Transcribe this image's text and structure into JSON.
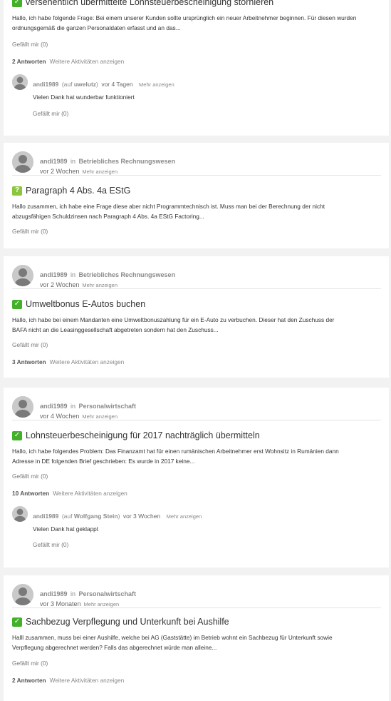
{
  "posts": [
    {
      "title": "versehentlich übermittelte Lohnsteuerbescheinigung stornieren",
      "status": "answered",
      "excerpt": "Hallo,   ich habe folgende Frage:   Bei einem unserer Kunden sollte ursprünglich ein neuer Arbeitnehmer beginnen. Für diesen wurden ordnungsgemäß die ganzen Personaldaten erfasst und an das...",
      "likes": "Gefällt mir (0)",
      "answers": "2 Antworten",
      "activities": "Weitere Aktivitäten anzeigen",
      "reply": {
        "user": "andi1989",
        "paren_open": "(auf ",
        "to": "uwelutz",
        "paren_close": ")",
        "time": "vor 4 Tagen",
        "more": "Mehr anzeigen",
        "text": "Vielen Dank hat wunderbar funktioniert",
        "likes": "Gefällt mir (0)"
      }
    },
    {
      "user": "andi1989",
      "in": "in",
      "place": "Betriebliches Rechnungswesen",
      "time": "vor 2 Wochen",
      "more": "Mehr anzeigen",
      "title": "Paragraph 4 Abs. 4a EStG",
      "status": "open",
      "status_glyph": "?",
      "excerpt_lines": [
        "Hallo zusammen,   ich habe eine Frage diese aber nicht Programmtechnisch ist.   Muss man bei der Berechnung der nicht",
        "abzugsfähigen Schuldzinsen nach Paragraph 4 Abs. 4a EStG Factoring..."
      ],
      "likes": "Gefällt mir (0)"
    },
    {
      "user": "andi1989",
      "in": "in",
      "place": "Betriebliches Rechnungswesen",
      "time": "vor 2 Wochen",
      "more": "Mehr anzeigen",
      "title": "Umweltbonus E-Autos buchen",
      "status": "answered",
      "excerpt_lines": [
        "Hallo,   ich habe bei einem Mandanten eine Umweltbonuszahlung für ein E-Auto zu verbuchen.   Dieser hat den Zuschuss der",
        "BAFA nicht an die Leasinggesellschaft abgetreten sondern hat den Zuschuss..."
      ],
      "likes": "Gefällt mir (0)",
      "answers": "3 Antworten",
      "activities": "Weitere Aktivitäten anzeigen"
    },
    {
      "user": "andi1989",
      "in": "in",
      "place": "Personalwirtschaft",
      "time": "vor 4 Wochen",
      "more": "Mehr anzeigen",
      "title": "Lohnsteuerbescheinigung für 2017 nachträglich übermitteln",
      "status": "answered",
      "excerpt_lines": [
        "Hallo,   ich habe folgendes Problem:   Das Finanzamt hat für einen rumänischen Arbeitnehmer erst Wohnsitz in Rumänien dann",
        "Adresse in DE folgenden Brief geschrieben:   Es wurde in 2017 keine..."
      ],
      "likes": "Gefällt mir (0)",
      "answers": "10 Antworten",
      "activities": "Weitere Aktivitäten anzeigen",
      "reply": {
        "user": "andi1989",
        "paren_open": "(auf ",
        "to": "Wolfgang Stein",
        "paren_close": ")",
        "time": "vor 3 Wochen",
        "more": "Mehr anzeigen",
        "text": "Vielen Dank hat geklappt",
        "likes": "Gefällt mir (0)"
      }
    },
    {
      "user": "andi1989",
      "in": "in",
      "place": "Personalwirtschaft",
      "time": "vor 3 Monaten",
      "more": "Mehr anzeigen",
      "title": "Sachbezug Verpflegung und Unterkunft bei Aushilfe",
      "status": "answered",
      "excerpt_lines": [
        "Halll zusammen,   muss bei einer Aushilfe, welche bei AG (Gaststätte) im Betrieb wohnt ein Sachbezug für Unterkunft sowie",
        "Verpflegung abgerechnet werden?   Falls das abgerechnet würde man alleine..."
      ],
      "likes": "Gefällt mir (0)",
      "answers": "2 Antworten",
      "activities": "Weitere Aktivitäten anzeigen"
    }
  ],
  "colors": {
    "answered": "#43b02a",
    "open": "#8cc63f",
    "background": "#f2f2f2"
  },
  "icons": {
    "answered": "answered-check-icon",
    "open": "open-question-icon",
    "avatar": "default-avatar-icon"
  }
}
